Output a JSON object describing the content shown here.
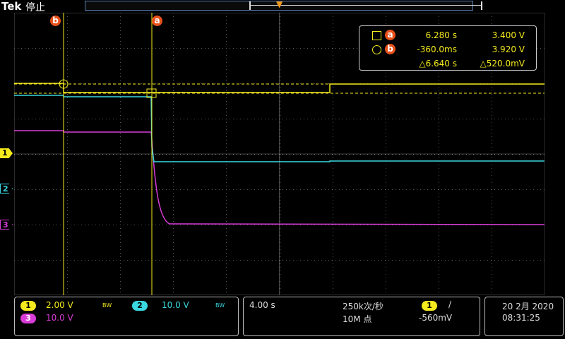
{
  "header": {
    "brand": "Tek",
    "status": "停止",
    "trigger_marker": "T"
  },
  "cursors": {
    "a_label": "a",
    "b_label": "b"
  },
  "channel_markers": [
    "1",
    "2",
    "3"
  ],
  "readout": {
    "a": {
      "label": "a",
      "time": "6.280 s",
      "value": "3.400 V"
    },
    "b": {
      "label": "b",
      "time": "-360.0ms",
      "value": "3.920 V"
    },
    "delta": {
      "time": "△6.640 s",
      "value": "△520.0mV"
    }
  },
  "bottom": {
    "ch1": {
      "num": "1",
      "scale": "2.00 V",
      "bw": "BW"
    },
    "ch2": {
      "num": "2",
      "scale": "10.0 V",
      "bw": "BW"
    },
    "ch3": {
      "num": "3",
      "scale": "10.0 V"
    },
    "timebase": "4.00 s",
    "sample_rate": "250k次/秒",
    "record_length": "10M 点",
    "trigger": {
      "source": "1",
      "slope": "/",
      "level": "-560mV"
    },
    "date": "20 2月 2020",
    "time": "08:31:25"
  },
  "colors": {
    "ch1": "#f4ea1e",
    "ch2": "#3ad7e0",
    "ch3": "#d83cd8",
    "cursor_badge": "#e8501a",
    "grid": "#6a6a6a"
  }
}
